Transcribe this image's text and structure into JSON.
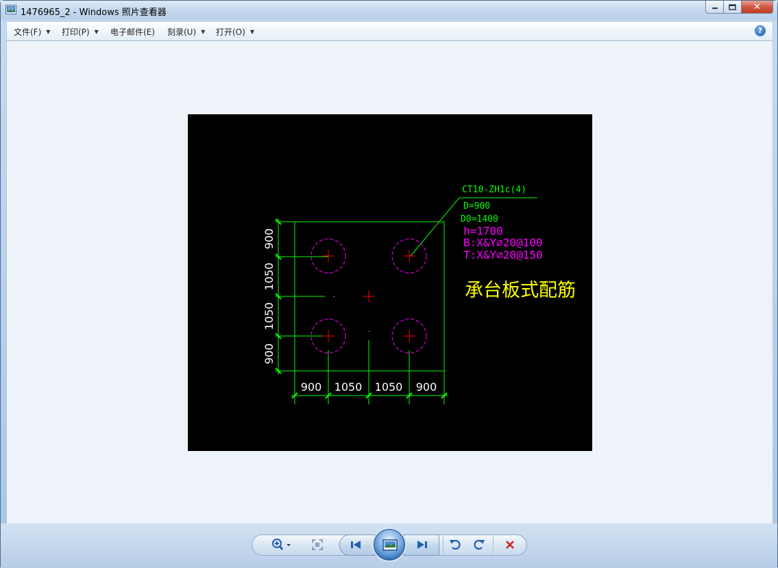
{
  "window": {
    "title": "1476965_2 - Windows 照片查看器",
    "minimize_glyph": "▭",
    "maximize_glyph": "▢",
    "close_glyph": "✕"
  },
  "menubar": {
    "items": [
      {
        "label": "文件(F)",
        "has_dropdown": true
      },
      {
        "label": "打印(P)",
        "has_dropdown": true
      },
      {
        "label": "电子邮件(E)",
        "has_dropdown": false
      },
      {
        "label": "刻录(U)",
        "has_dropdown": true
      },
      {
        "label": "打开(O)",
        "has_dropdown": true
      }
    ],
    "help_glyph": "?"
  },
  "drawing": {
    "tag": "CT10-ZH1c(4)",
    "d": "D=900",
    "d0": "D0=1400",
    "h": "h=1700",
    "bottom_rebar": "B:X&Y⌀20@100",
    "top_rebar": "T:X&Y⌀20@150",
    "title": "承台板式配筋",
    "left_dims": [
      "900",
      "1050",
      "1050",
      "900"
    ],
    "bottom_dims": [
      "900",
      "1050",
      "1050",
      "900"
    ],
    "colors": {
      "green": "#00ff00",
      "magenta": "#ff00ff",
      "red": "#ff0000",
      "yellow": "#ffff00",
      "white": "#ffffff"
    }
  },
  "toolbar": {
    "zoom": "zoom-icon",
    "actual_size": "actual-size-icon",
    "previous": "previous-icon",
    "slideshow": "slideshow-icon",
    "next": "next-icon",
    "rotate_ccw": "rotate-counterclockwise-icon",
    "rotate_cw": "rotate-clockwise-icon",
    "delete": "delete-icon"
  }
}
